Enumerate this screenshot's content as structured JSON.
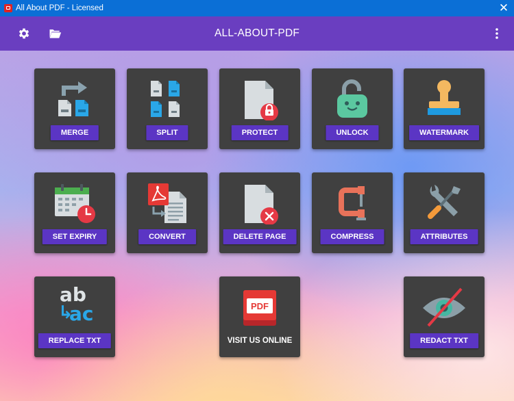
{
  "window": {
    "title": "All About PDF - Licensed",
    "close_glyph": "✕"
  },
  "appbar": {
    "title": "ALL-ABOUT-PDF",
    "left_icons": [
      "settings-gear-icon",
      "folder-open-icon"
    ],
    "right_icon": "more-vertical-icon"
  },
  "tools": [
    {
      "label": "MERGE",
      "icon": "merge-icon"
    },
    {
      "label": "SPLIT",
      "icon": "split-icon"
    },
    {
      "label": "PROTECT",
      "icon": "protect-lock-icon"
    },
    {
      "label": "UNLOCK",
      "icon": "unlock-padlock-icon"
    },
    {
      "label": "WATERMARK",
      "icon": "stamp-icon"
    },
    {
      "label": "SET EXPIRY",
      "icon": "calendar-clock-icon"
    },
    {
      "label": "CONVERT",
      "icon": "pdf-convert-icon"
    },
    {
      "label": "DELETE PAGE",
      "icon": "delete-page-icon"
    },
    {
      "label": "COMPRESS",
      "icon": "clamp-icon"
    },
    {
      "label": "ATTRIBUTES",
      "icon": "tools-icon"
    },
    {
      "label": "REPLACE TXT",
      "icon": "replace-text-icon"
    },
    {
      "label": "VISIT US ONLINE",
      "icon": "pdf-badge-icon",
      "badge": "PDF"
    },
    {
      "label": "REDACT TXT",
      "icon": "eye-slash-icon"
    }
  ],
  "art_text": {
    "replace_top": "ab",
    "replace_bottom": "ac",
    "replace_arrow": "↳"
  },
  "colors": {
    "title_bar": "#0b6fd6",
    "app_bar": "#6a3ec0",
    "tile": "#404040",
    "label_button": "#5b35c4",
    "pdf_red": "#e53935"
  }
}
